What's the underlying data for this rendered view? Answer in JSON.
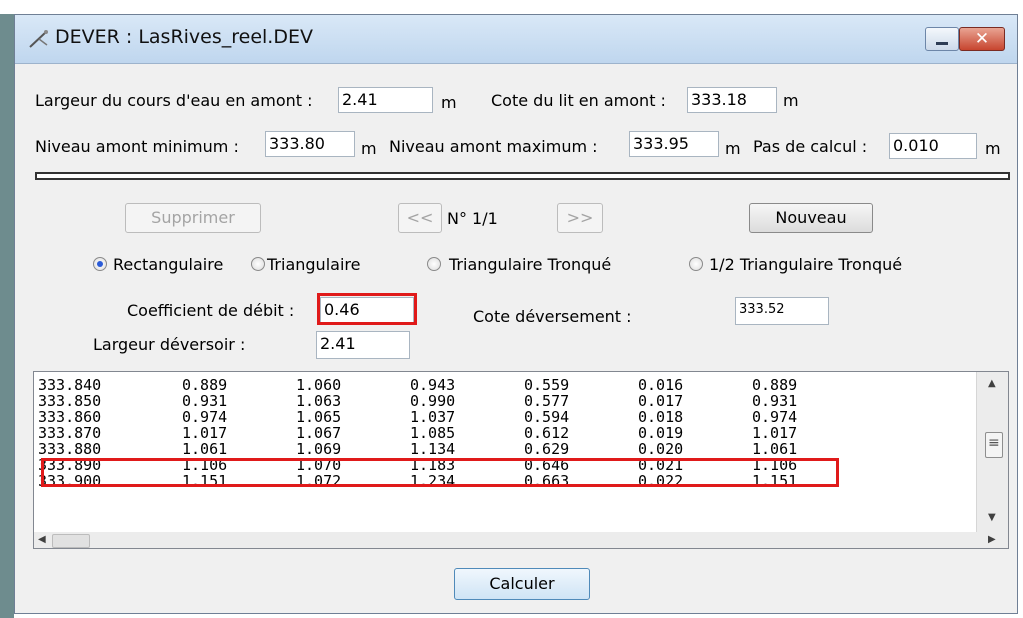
{
  "window": {
    "title": "DEVER : LasRives_reel.DEV"
  },
  "params": {
    "largeur_label": "Largeur du cours d'eau en amont :",
    "largeur_value": "2.41",
    "unit": "m",
    "cote_lit_label": "Cote du lit en amont :",
    "cote_lit_value": "333.18",
    "niveau_min_label": "Niveau amont minimum :",
    "niveau_min_value": "333.80",
    "niveau_max_label": "Niveau amont maximum :",
    "niveau_max_value": "333.95",
    "pas_label": "Pas de calcul :",
    "pas_value": "0.010"
  },
  "toolbar": {
    "supprimer_label": "Supprimer",
    "prev_label": "<<",
    "counter_label": "N°  1/1",
    "next_label": ">>",
    "nouveau_label": "Nouveau"
  },
  "shapes": [
    {
      "label": "Rectangulaire",
      "selected": true
    },
    {
      "label": "Triangulaire",
      "selected": false
    },
    {
      "label": "Triangulaire Tronqué",
      "selected": false
    },
    {
      "label": "1/2 Triangulaire Tronqué",
      "selected": false
    }
  ],
  "deversoir": {
    "coef_label": "Coefficient de débit :",
    "coef_value": "0.46",
    "cote_dev_label": "Cote déversement :",
    "cote_dev_value": "333.52",
    "largeur_dev_label": "Largeur déversoir :",
    "largeur_dev_value": "2.41"
  },
  "results": {
    "rows": [
      [
        "333.840",
        "0.889",
        "1.060",
        "0.943",
        "0.559",
        "0.016",
        "0.889"
      ],
      [
        "333.850",
        "0.931",
        "1.063",
        "0.990",
        "0.577",
        "0.017",
        "0.931"
      ],
      [
        "333.860",
        "0.974",
        "1.065",
        "1.037",
        "0.594",
        "0.018",
        "0.974"
      ],
      [
        "333.870",
        "1.017",
        "1.067",
        "1.085",
        "0.612",
        "0.019",
        "1.017"
      ],
      [
        "333.880",
        "1.061",
        "1.069",
        "1.134",
        "0.629",
        "0.020",
        "1.061"
      ],
      [
        "333.890",
        "1.106",
        "1.070",
        "1.183",
        "0.646",
        "0.021",
        "1.106"
      ],
      [
        "333.900",
        "1.151",
        "1.072",
        "1.234",
        "0.663",
        "0.022",
        "1.151"
      ]
    ],
    "highlighted_row": 4
  },
  "calculer_label": "Calculer",
  "colors": {
    "highlight": "#e01a1a",
    "radio_selected": "#2a5bd7"
  },
  "icons": {
    "window": "compass-icon",
    "minimize": "minimize-icon",
    "close": "close-icon"
  }
}
